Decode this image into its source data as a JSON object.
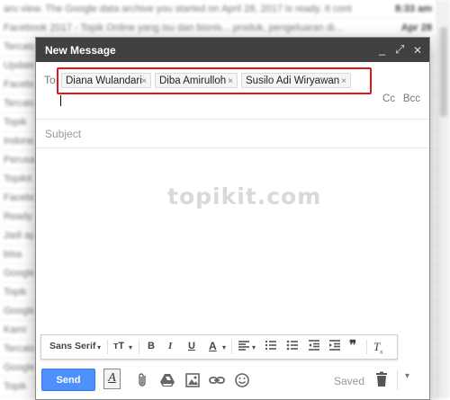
{
  "background": {
    "rows": [
      {
        "text": "aru view. The Google data archive you started on April 28, 2017 is ready. It cont",
        "time": "8:33 am"
      },
      {
        "text": "Facebook 2017 - Topik Online yang isu dan bisnis... produk, pengeluaran di...",
        "time": "Apr 28"
      },
      {
        "text": "Tercatat",
        "time": ""
      },
      {
        "text": "Update",
        "time": ""
      },
      {
        "text": "Facebook",
        "time": ""
      },
      {
        "text": "Tercatat",
        "time": ""
      },
      {
        "text": "Topik",
        "time": ""
      },
      {
        "text": "Indonesia",
        "time": ""
      },
      {
        "text": "Perusahaan",
        "time": ""
      },
      {
        "text": "Topikit",
        "time": ""
      },
      {
        "text": "Facebook",
        "time": ""
      },
      {
        "text": "Ready",
        "time": ""
      },
      {
        "text": "Jadi apa",
        "time": ""
      },
      {
        "text": "bisa",
        "time": ""
      },
      {
        "text": "Google",
        "time": ""
      },
      {
        "text": "Topik",
        "time": ""
      },
      {
        "text": "Google",
        "time": ""
      },
      {
        "text": "Kami",
        "time": ""
      },
      {
        "text": "Tercatat",
        "time": ""
      },
      {
        "text": "Google",
        "time": ""
      },
      {
        "text": "Topik",
        "time": ""
      }
    ]
  },
  "compose": {
    "title": "New Message",
    "controls": {
      "minimize": "_",
      "popout": "⤢",
      "close": "✕"
    },
    "to_label": "To",
    "recipients": [
      {
        "name": "Diana Wulandari"
      },
      {
        "name": "Diba Amirulloh"
      },
      {
        "name": "Susilo Adi Wiryawan"
      }
    ],
    "chip_remove": "×",
    "cc_label": "Cc",
    "bcc_label": "Bcc",
    "subject_placeholder": "Subject",
    "watermark": "topikit.com",
    "formatting": {
      "font": "Sans Serif",
      "size": "тT",
      "bold": "B",
      "italic": "I",
      "underline": "U",
      "text_color": "A",
      "clear_formatting": "T"
    },
    "send_label": "Send",
    "format_toggle": "A",
    "saved_label": "Saved",
    "more_options": "▾"
  }
}
